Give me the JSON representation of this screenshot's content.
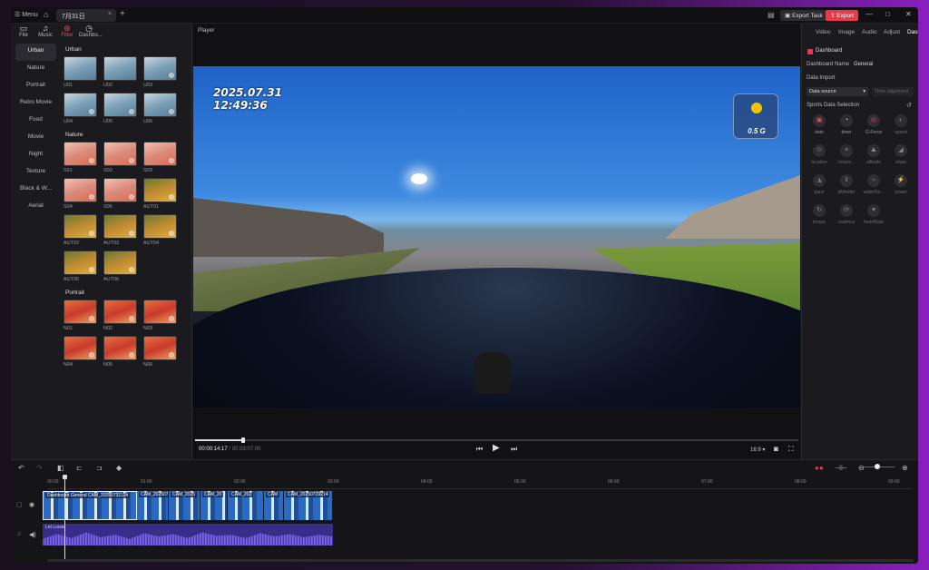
{
  "titlebar": {
    "menu": "☰ Menu",
    "tab": "7月31日",
    "export_task": "Export Task",
    "export": "Export"
  },
  "left": {
    "tabs": [
      {
        "label": "File",
        "icon": "folder-icon"
      },
      {
        "label": "Music",
        "icon": "music-icon"
      },
      {
        "label": "Filter",
        "icon": "filter-icon"
      },
      {
        "label": "Dashbo...",
        "icon": "dashboard-icon"
      }
    ],
    "categories": [
      "Urban",
      "Nature",
      "Portrait",
      "Retro Movie",
      "Food",
      "Movie",
      "Night",
      "Texture",
      "Black & W...",
      "Aerial"
    ],
    "sections": [
      {
        "title": "Urban",
        "items": [
          "U01",
          "U02",
          "U03",
          "U04",
          "U05",
          "U06"
        ]
      },
      {
        "title": "Nature",
        "items": [
          "S01",
          "S02",
          "S03",
          "S04",
          "S05",
          "AUT01",
          "AUT02",
          "AUT03",
          "AUT04",
          "AUT05",
          "AUT06"
        ]
      },
      {
        "title": "Portrait",
        "items": [
          "N01",
          "N02",
          "N03",
          "N04",
          "N05",
          "N06"
        ]
      }
    ]
  },
  "player": {
    "title": "Player",
    "osd_date": "2025.07.31",
    "osd_time": "12:49:36",
    "gforce": "0.5 G",
    "time_current": "00:00:14:17",
    "time_total": "/ 00:03:07:00",
    "ratio": "16:9 ▾"
  },
  "right": {
    "tabs": [
      "Video",
      "Image",
      "Audio",
      "Adjust",
      "Dashb"
    ],
    "dashboard_label": "Dashboard",
    "dashboard_name_label": "Dashboard Name",
    "dashboard_name_value": "General",
    "data_import": "Data Import",
    "data_source": "Data source",
    "time_alignment": "Time alignment",
    "sports_title": "Sports Data Selection",
    "sports": [
      {
        "name": "date",
        "state": "on"
      },
      {
        "name": "timer",
        "state": "white"
      },
      {
        "name": "G-Force",
        "state": "on"
      },
      {
        "name": "speed",
        "state": "off"
      },
      {
        "name": "location",
        "state": "off"
      },
      {
        "name": "totaris...",
        "state": "off"
      },
      {
        "name": "altitude",
        "state": "off"
      },
      {
        "name": "slope",
        "state": "off"
      },
      {
        "name": "pace",
        "state": "off"
      },
      {
        "name": "altimeter",
        "state": "off"
      },
      {
        "name": "waterDe...",
        "state": "off"
      },
      {
        "name": "power",
        "state": "off"
      },
      {
        "name": "torque",
        "state": "off"
      },
      {
        "name": "cadence",
        "state": "off"
      },
      {
        "name": "heartRate",
        "state": "off"
      }
    ]
  },
  "timeline": {
    "ruler": [
      "00:00",
      "01:00",
      "02:00",
      "03:00",
      "04:00",
      "05:00",
      "06:00",
      "07:00",
      "08:00",
      "09:00"
    ],
    "clips": [
      "Dashboard General  CAM_20250731124",
      "CAM_2025073",
      "CAM_2025",
      "CAM_20",
      "CAM_202",
      "CAM",
      "CAM_20250729214"
    ],
    "audio_label": "Let Loose"
  }
}
